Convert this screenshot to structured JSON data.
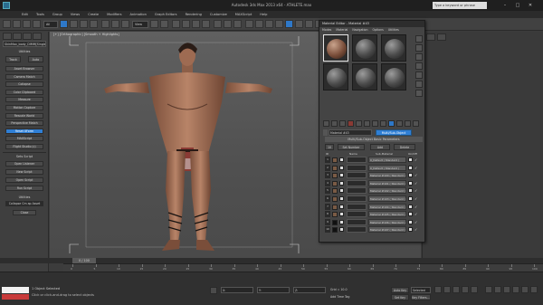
{
  "titlebar": {
    "title": "Autodesk 3ds Max 2013 x64 - ATHLETE.max",
    "search_placeholder": "Type a keyword or phrase"
  },
  "menu": [
    "Edit",
    "Tools",
    "Group",
    "Views",
    "Create",
    "Modifiers",
    "Animation",
    "Graph Editors",
    "Rendering",
    "Customize",
    "MAXScript",
    "Help"
  ],
  "toolbar": {
    "selection_set": "All",
    "view_dropdown": "View"
  },
  "left_panel": {
    "object_name": "SkinMax_body_DIMM[Single]",
    "tabs": [
      "Track",
      "Auto"
    ],
    "utilities_title": "Utilities",
    "buttons": [
      "Asset Browser",
      "Camera Match",
      "Collapse",
      "Color Clipboard",
      "Measure",
      "Motion Capture",
      "Rescale World",
      "Perspective Match",
      "Reset XForm",
      "MAXScript",
      "Flight Studio (c)"
    ],
    "active_button_index": 8,
    "lower_title": "Sets Script",
    "lower_buttons": [
      "Open Listener",
      "New Script",
      "Open Script",
      "Run Script"
    ],
    "utilities2_title": "Utilities",
    "utilities2_dropdown": "Collapse Cm ap Asset",
    "close_label": "Close"
  },
  "viewport": {
    "label": "[+] [Orthographic] [Smooth + Highlights]"
  },
  "material_editor": {
    "title": "Material Editor - Material #43",
    "menu": [
      "Modes",
      "Material",
      "Navigation",
      "Options",
      "Utilities"
    ],
    "material_name": "Material #43",
    "material_type": "Multi/Sub-Object",
    "rollout_title": "Multi/Sub-Object Basic Parameters",
    "count_value": "10",
    "set_number": "Set Number",
    "add": "Add",
    "delete": "Delete",
    "headers": {
      "id": "ID",
      "name": "Name",
      "sub_material": "Sub-Material",
      "onoff": "On/Off"
    },
    "rows": [
      {
        "id": "1",
        "mat": "0_Default ( Standard )"
      },
      {
        "id": "2",
        "mat": "0_Default ( Standard )"
      },
      {
        "id": "3",
        "mat": "Material #100 ( Standard )"
      },
      {
        "id": "4",
        "mat": "Material #101 ( Standard )"
      },
      {
        "id": "5",
        "mat": "Material #102 ( Standard )"
      },
      {
        "id": "6",
        "mat": "Material #103 ( Standard )"
      },
      {
        "id": "7",
        "mat": "Material #104 ( Standard )"
      },
      {
        "id": "8",
        "mat": "Material #105 ( Standard )"
      },
      {
        "id": "9",
        "mat": "Material #106 ( Standard )"
      },
      {
        "id": "10",
        "mat": "Material #107 ( Standard )"
      }
    ]
  },
  "timeline": {
    "slider_label": "0 / 100",
    "ticks": [
      "0",
      "5",
      "10",
      "15",
      "20",
      "25",
      "30",
      "35",
      "40",
      "45",
      "50",
      "55",
      "60",
      "65",
      "70",
      "75",
      "80",
      "85",
      "90",
      "95",
      "100"
    ]
  },
  "status": {
    "selection": "1 Object Selected",
    "prompt": "Click or click-and-drag to select objects",
    "x": "X:",
    "y": "Y:",
    "z": "Z:",
    "grid": "Grid = 10.0",
    "auto_key": "Auto Key",
    "set_key": "Set Key",
    "selected": "Selected",
    "key_filters": "Key Filters...",
    "add_time_tag": "Add Time Tag"
  },
  "colors": {
    "accent": "#2f7fd5",
    "skin": "#b07a5e",
    "viewport_bg": "#585858"
  }
}
